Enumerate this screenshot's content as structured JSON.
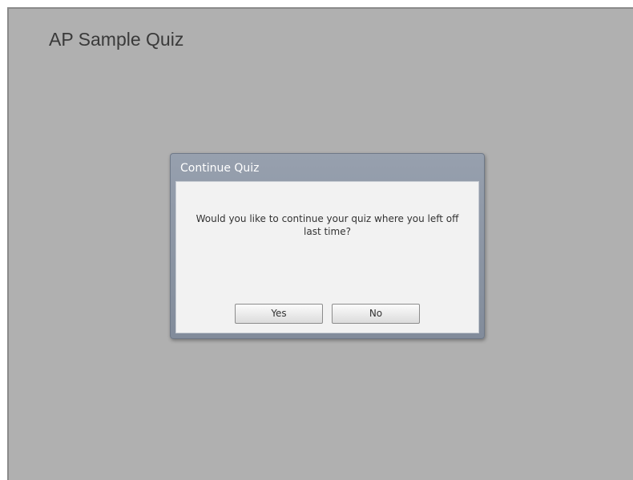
{
  "quiz": {
    "title": "AP Sample Quiz"
  },
  "dialog": {
    "title": "Continue Quiz",
    "message": "Would you like to continue your quiz where you left off last time?",
    "yes_label": "Yes",
    "no_label": "No"
  },
  "colors": {
    "stage_background": "#b0b0b0",
    "dialog_header": "#8d97a6",
    "dialog_body": "#f2f2f2"
  }
}
